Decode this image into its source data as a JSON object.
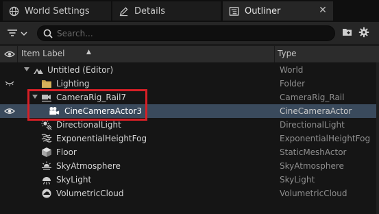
{
  "tabs": [
    {
      "label": "World Settings",
      "icon": "globe-icon"
    },
    {
      "label": "Details",
      "icon": "pencil-icon"
    },
    {
      "label": "Outliner",
      "icon": "list-icon",
      "active": true
    }
  ],
  "toolbar": {
    "search_placeholder": "Search...",
    "filter_icon": "filter-icon",
    "add_folder_icon": "add-folder-icon",
    "settings_icon": "gear-icon"
  },
  "header": {
    "item_label": "Item Label",
    "type": "Type",
    "sort": "▲"
  },
  "rows": [
    {
      "label": "Untitled (Editor)",
      "type": "World",
      "icon": "world-icon",
      "expanded": true
    },
    {
      "label": "Lighting",
      "type": "Folder",
      "icon": "folder-icon"
    },
    {
      "label": "CameraRig_Rail7",
      "type": "CameraRig_Rail",
      "icon": "camera-rig-icon",
      "expanded": true
    },
    {
      "label": "CineCameraActor3",
      "type": "CineCameraActor",
      "icon": "cine-camera-icon",
      "selected": true
    },
    {
      "label": "DirectionalLight",
      "type": "DirectionalLight",
      "icon": "sun-icon"
    },
    {
      "label": "ExponentialHeightFog",
      "type": "ExponentialHeightFog",
      "icon": "fog-icon"
    },
    {
      "label": "Floor",
      "type": "StaticMeshActor",
      "icon": "cube-icon"
    },
    {
      "label": "SkyAtmosphere",
      "type": "SkyAtmosphere",
      "icon": "sky-atmosphere-icon"
    },
    {
      "label": "SkyLight",
      "type": "SkyLight",
      "icon": "skylight-icon"
    },
    {
      "label": "VolumetricCloud",
      "type": "VolumetricCloud",
      "icon": "cloud-icon"
    }
  ],
  "colors": {
    "selection": "#3a4a5c",
    "highlight_box": "#d61f26",
    "folder": "#c9a24a"
  }
}
